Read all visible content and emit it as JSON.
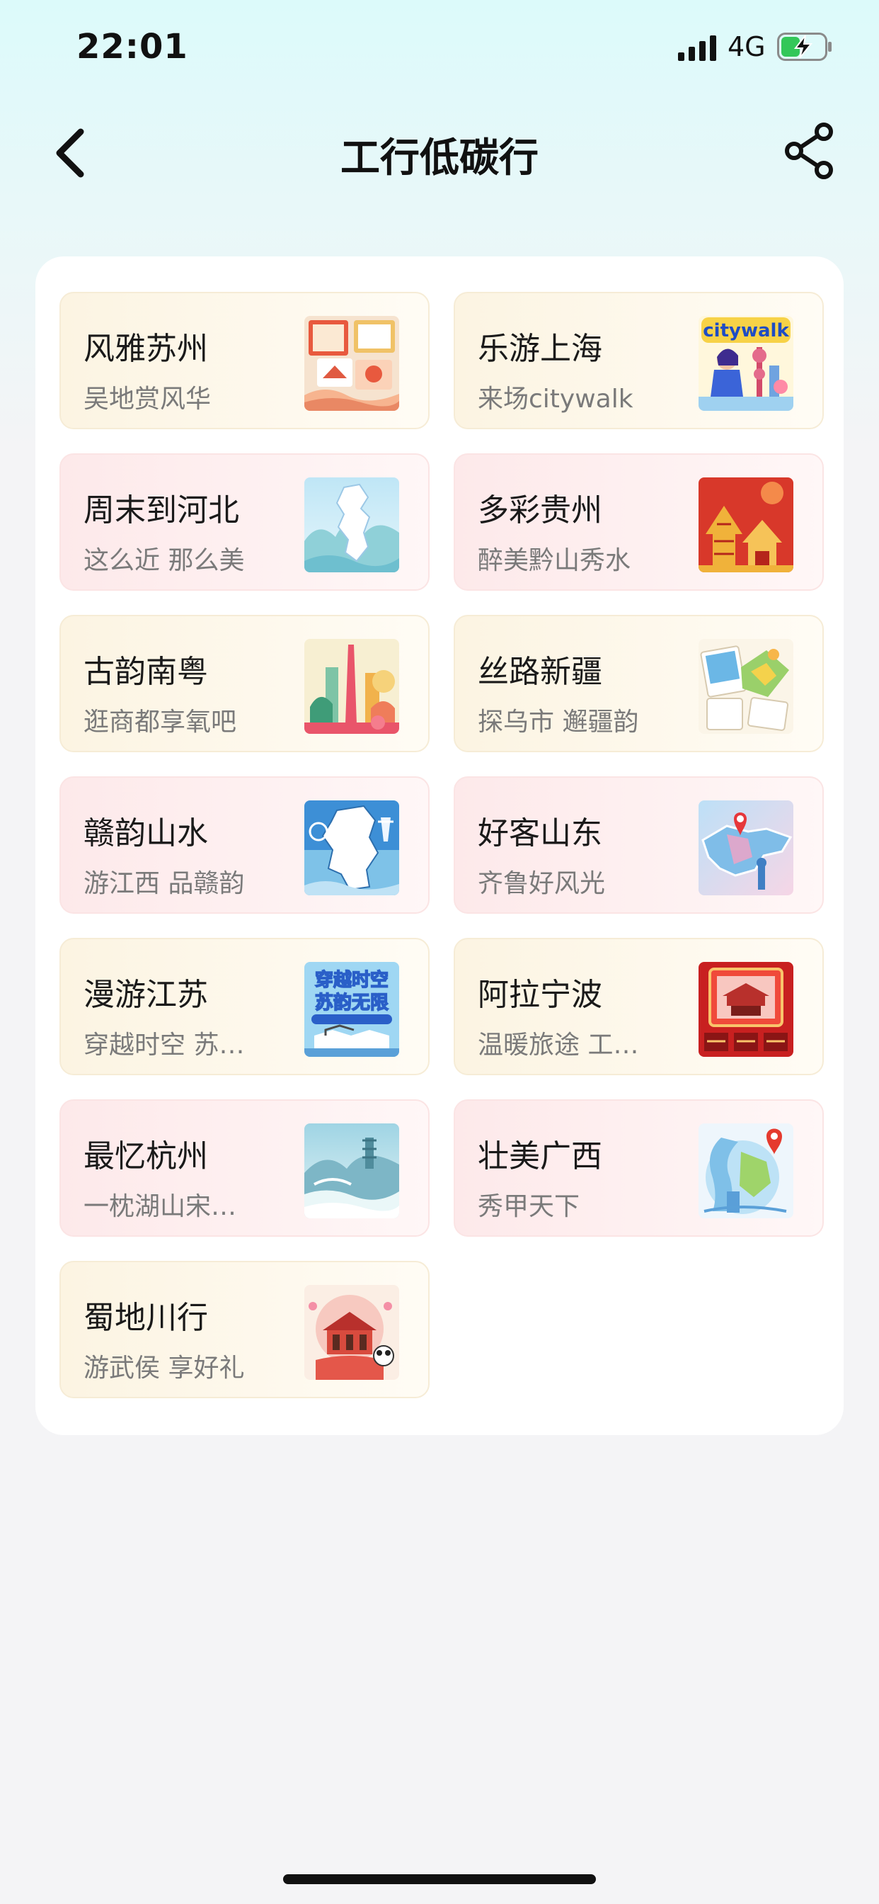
{
  "status_bar": {
    "time": "22:01",
    "network": "4G"
  },
  "header": {
    "title": "工行低碳行"
  },
  "cities": [
    {
      "title": "风雅苏州",
      "subtitle": "吴地赏风华",
      "icon": "suzhou-illustration"
    },
    {
      "title": "乐游上海",
      "subtitle": "来场citywalk",
      "icon": "shanghai-citywalk-illustration",
      "image_text": "citywalk"
    },
    {
      "title": "周末到河北",
      "subtitle": "这么近 那么美",
      "icon": "hebei-map-illustration"
    },
    {
      "title": "多彩贵州",
      "subtitle": "醉美黔山秀水",
      "icon": "guizhou-illustration"
    },
    {
      "title": "古韵南粤",
      "subtitle": "逛商都享氧吧",
      "icon": "guangdong-illustration"
    },
    {
      "title": "丝路新疆",
      "subtitle": "探乌市 邂疆韵",
      "icon": "xinjiang-illustration"
    },
    {
      "title": "赣韵山水",
      "subtitle": "游江西 品赣韵",
      "icon": "jiangxi-map-illustration"
    },
    {
      "title": "好客山东",
      "subtitle": "齐鲁好风光",
      "icon": "shandong-map-illustration"
    },
    {
      "title": "漫游江苏",
      "subtitle": "穿越时空 苏…",
      "icon": "jiangsu-illustration",
      "image_text_1": "穿越时空",
      "image_text_2": "苏韵无限"
    },
    {
      "title": "阿拉宁波",
      "subtitle": "温暖旅途 工…",
      "icon": "ningbo-illustration"
    },
    {
      "title": "最忆杭州",
      "subtitle": "一枕湖山宋时梦",
      "icon": "hangzhou-illustration"
    },
    {
      "title": "壮美广西",
      "subtitle": "秀甲天下",
      "icon": "guangxi-illustration"
    },
    {
      "title": "蜀地川行",
      "subtitle": "游武侯 享好礼",
      "icon": "sichuan-illustration"
    }
  ],
  "colors": {
    "accent_pink": "#fde9ea",
    "accent_cream": "#fcf4e2",
    "title_text": "#111111",
    "subtitle_text": "#7a7a7a"
  }
}
